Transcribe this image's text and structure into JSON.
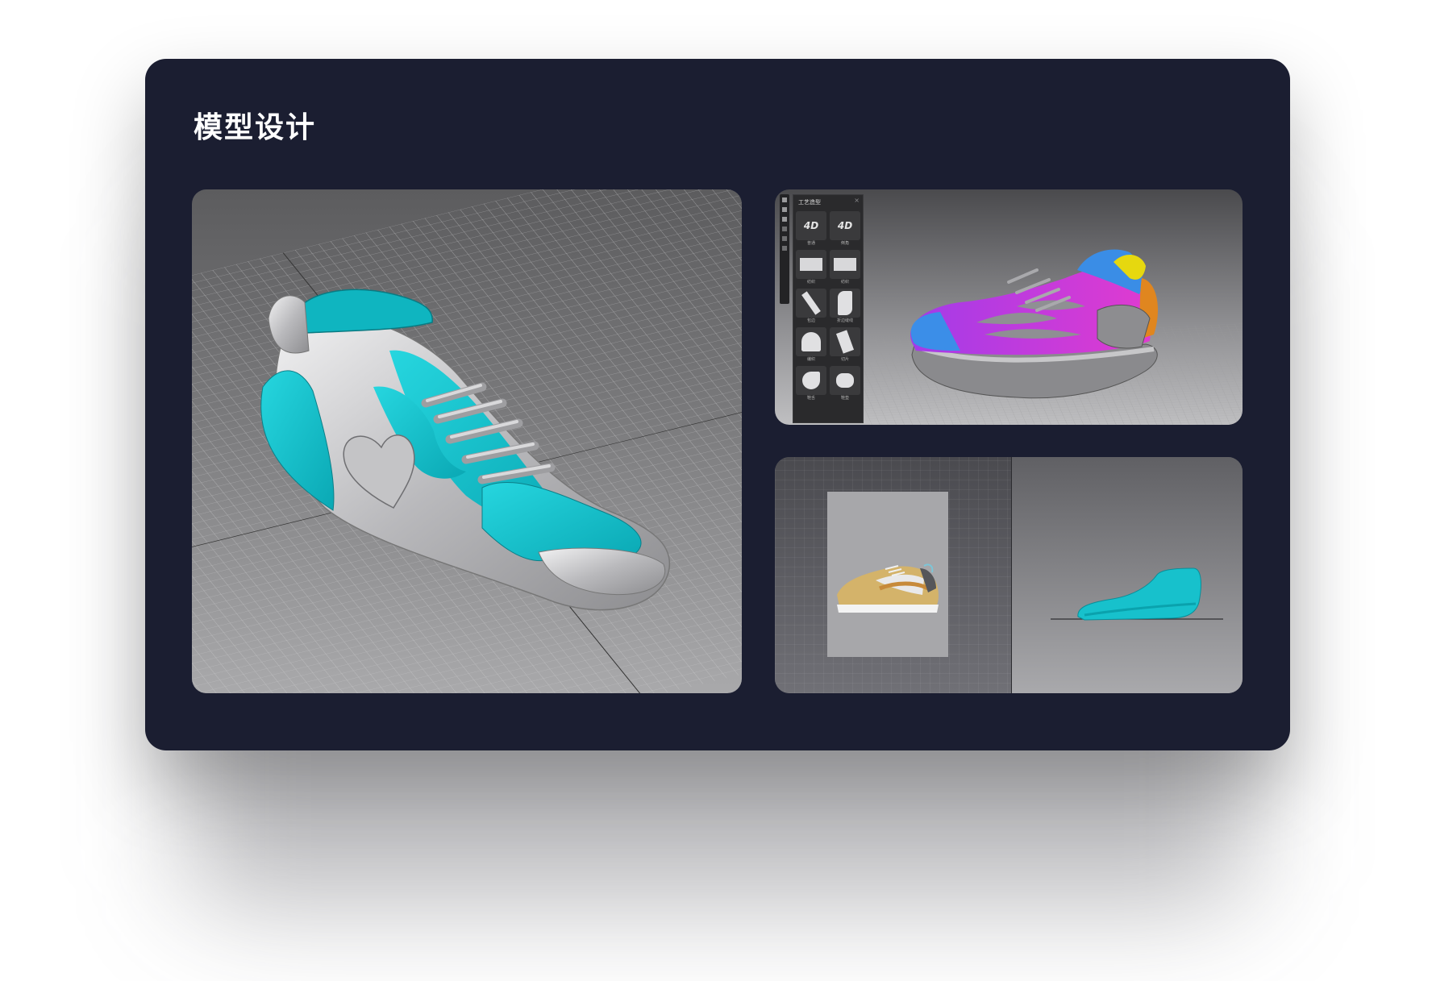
{
  "section": {
    "title": "模型设计"
  },
  "tool_panel": {
    "title": "工艺造型",
    "items": [
      {
        "label": "普通",
        "icon": "4d-logo-icon"
      },
      {
        "label": "倒角",
        "icon": "4d-logo-icon"
      },
      {
        "label": "纺织",
        "icon": "fabric-icon"
      },
      {
        "label": "纺织",
        "icon": "fabric-icon"
      },
      {
        "label": "包边",
        "icon": "edge-icon"
      },
      {
        "label": "折边缝线",
        "icon": "fold-seam-icon"
      },
      {
        "label": "编织",
        "icon": "weave-icon"
      },
      {
        "label": "切片",
        "icon": "slice-icon"
      },
      {
        "label": "鞋舌",
        "icon": "tongue-icon"
      },
      {
        "label": "鞋垫",
        "icon": "insole-icon"
      }
    ]
  },
  "colors": {
    "card_bg": "#1b1e31",
    "accent_cyan": "#17c1cc",
    "shoe_silver": "#c9c9cb"
  }
}
